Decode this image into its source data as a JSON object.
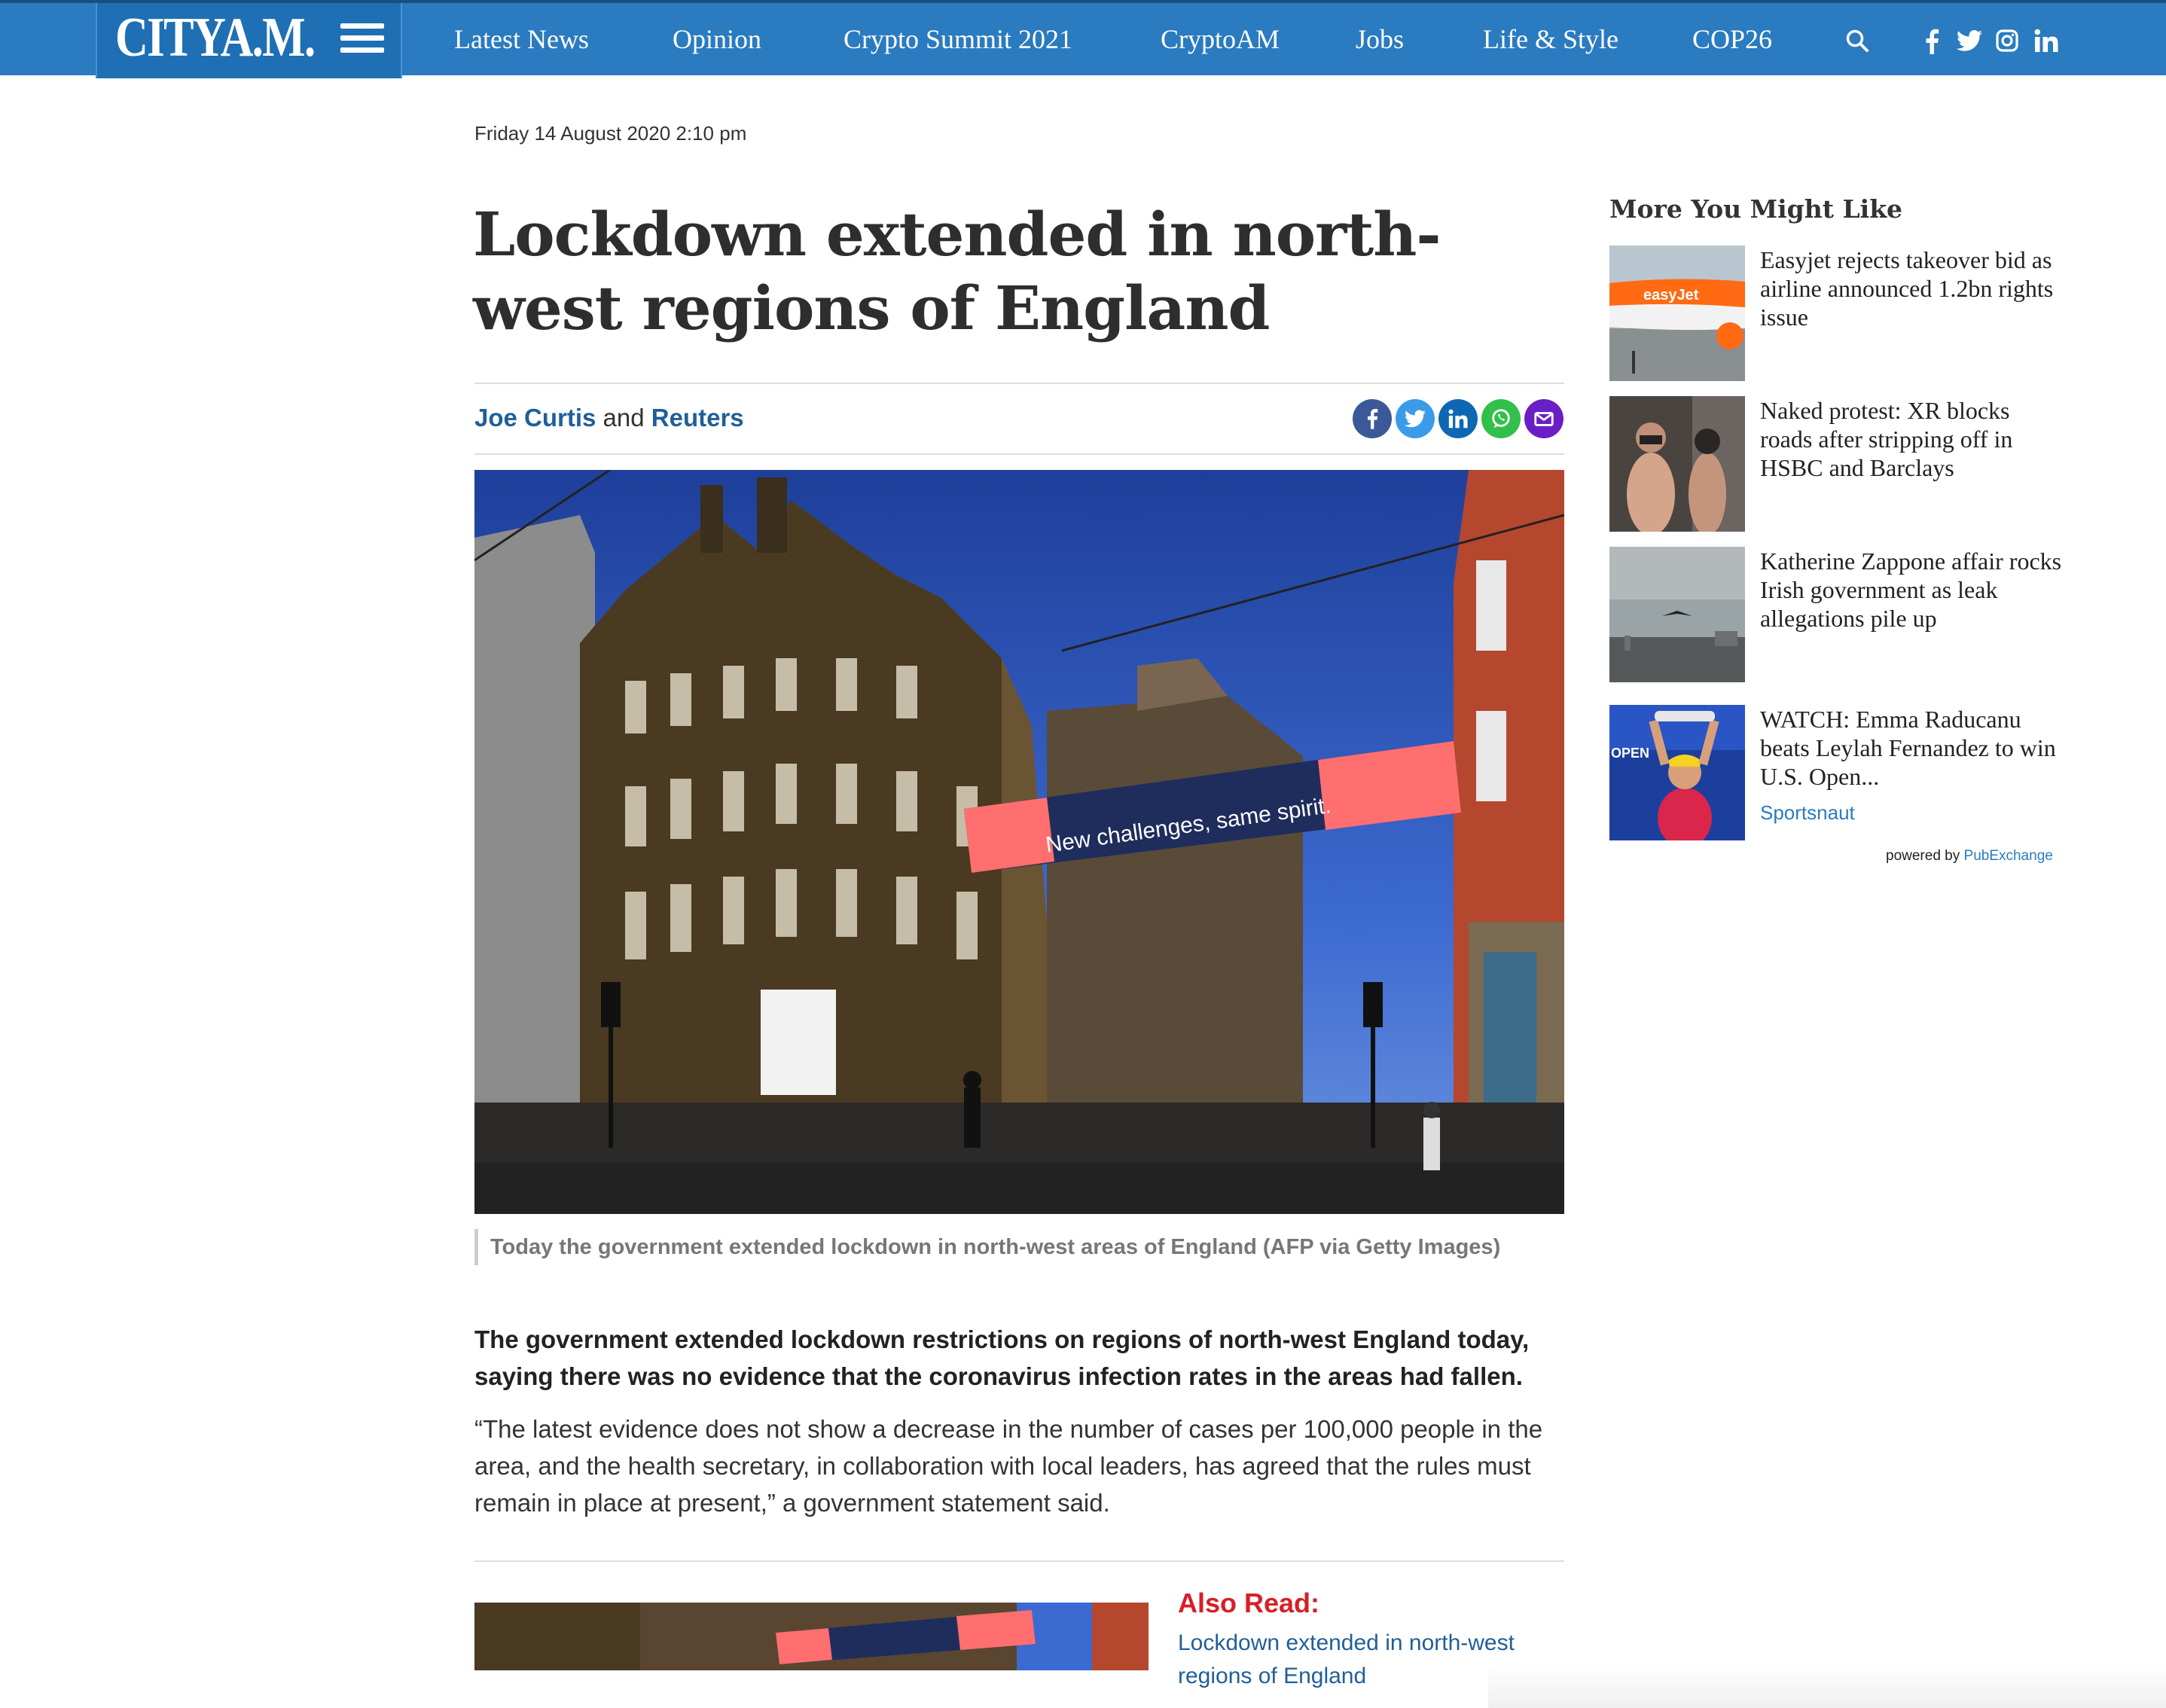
{
  "header": {
    "logo": "CITYA.M.",
    "nav": [
      "Latest News",
      "Opinion",
      "Crypto Summit 2021",
      "CryptoAM",
      "Jobs",
      "Life & Style",
      "COP26"
    ],
    "social_icons": [
      "search-icon",
      "facebook-icon",
      "twitter-icon",
      "instagram-icon",
      "linkedin-icon"
    ]
  },
  "article": {
    "date": "Friday 14 August 2020 2:10 pm",
    "headline": "Lockdown extended in north-west regions of England",
    "byline": {
      "author1": "Joe Curtis",
      "conjunction": "and",
      "author2": "Reuters"
    },
    "share_icons": [
      "facebook-share-icon",
      "twitter-share-icon",
      "linkedin-share-icon",
      "whatsapp-share-icon",
      "email-share-icon"
    ],
    "image_banner_text": "New challenges, same spirit.",
    "caption": "Today the government extended lockdown in north-west areas of England (AFP via Getty Images)",
    "lead": "The government extended lockdown restrictions on regions of north-west England today, saying there was no evidence that the coronavirus infection rates in the areas had fallen.",
    "paragraph": "“The latest evidence does not show a decrease in the number of cases per 100,000 people in the area, and the health secretary, in collaboration with local leaders, has agreed that the rules must remain in place at present,” a government statement said.",
    "also_read": {
      "label": "Also Read:",
      "link": "Lockdown extended in north-west regions of England"
    }
  },
  "sidebar": {
    "title": "More You Might Like",
    "items": [
      {
        "title": "Easyjet rejects takeover bid as airline announced 1.2bn rights issue",
        "source": ""
      },
      {
        "title": "Naked protest: XR blocks roads after stripping off in HSBC and Barclays",
        "source": ""
      },
      {
        "title": "Katherine Zappone affair rocks Irish government as leak allegations pile up",
        "source": ""
      },
      {
        "title": "WATCH: Emma Raducanu beats Leylah Fernandez to win U.S. Open...",
        "source": "Sportsnaut"
      }
    ],
    "powered_by": "powered by",
    "powered_brand": "PubExchange"
  },
  "colors": {
    "header_blue": "#2a7bc0",
    "link_blue": "#1f5f9a",
    "also_read_red": "#d81f26"
  }
}
